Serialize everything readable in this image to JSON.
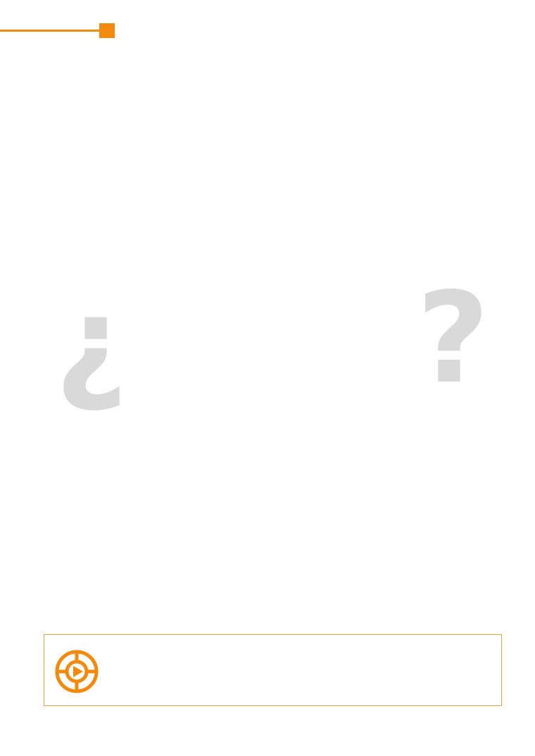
{
  "colors": {
    "accent": "#f28a0d",
    "accent_border": "#e8a13c",
    "question_mark": "#d9d9d9"
  },
  "decor": {
    "top_rule": "orange-rule",
    "top_marker": "orange-square"
  },
  "glyphs": {
    "open_question": "¿",
    "close_question": "?"
  },
  "callout": {
    "icon": "play-wheel-icon",
    "text": ""
  }
}
